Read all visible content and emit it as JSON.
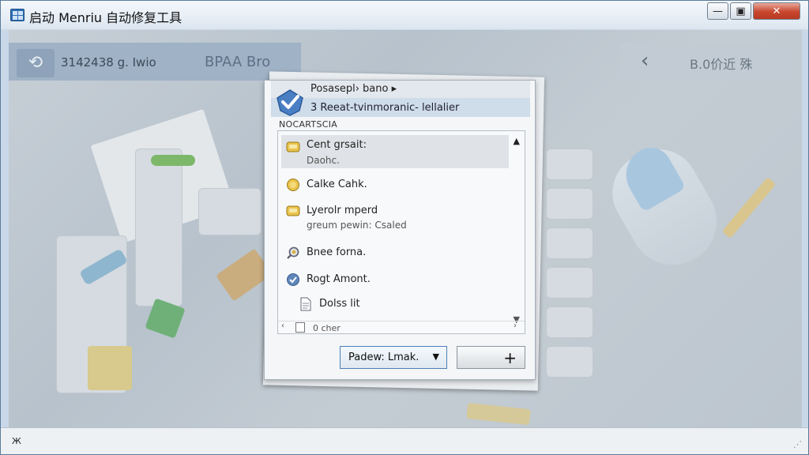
{
  "window": {
    "title": "启动 Menriu 自动修复工具",
    "buttons": {
      "minimize": "—",
      "maximize": "▣",
      "close": "✕"
    }
  },
  "toolbar": {
    "left_text": "3142438 g. Iwio",
    "center_text": "BPAA Bro",
    "right_text": "B.0价近 殊",
    "back_glyph": "‹"
  },
  "dialog": {
    "header": "Posasepl› bano ▸",
    "subheader": "3 Reeat-tvinmoranic- lellalier",
    "section_label": "NOCARTSCIA",
    "items": [
      {
        "title": "Cent grsait:",
        "subtitle": "Daohc.",
        "icon": "drive-yellow-icon",
        "selected": true
      },
      {
        "title": "Calke Cahk.",
        "subtitle": "",
        "icon": "coin-icon",
        "selected": false
      },
      {
        "title": "Lyerolr mperd",
        "subtitle": "greum pewin: Csaled",
        "icon": "drive-yellow-icon",
        "selected": false
      },
      {
        "title": "Bnee forna.",
        "subtitle": "",
        "icon": "magnifier-icon",
        "selected": false
      },
      {
        "title": "Rogt Amont.",
        "subtitle": "",
        "icon": "blue-disc-icon",
        "selected": false
      },
      {
        "title": "Dolss lit",
        "subtitle": "",
        "icon": "document-icon",
        "selected": false
      }
    ],
    "partial_item": "0 cher",
    "combo_label": "Padew: Lmak.",
    "plus_label": "+"
  },
  "status": {
    "text": "Ж"
  },
  "colors": {
    "accent": "#4d7fb5",
    "close": "#c8462e"
  }
}
